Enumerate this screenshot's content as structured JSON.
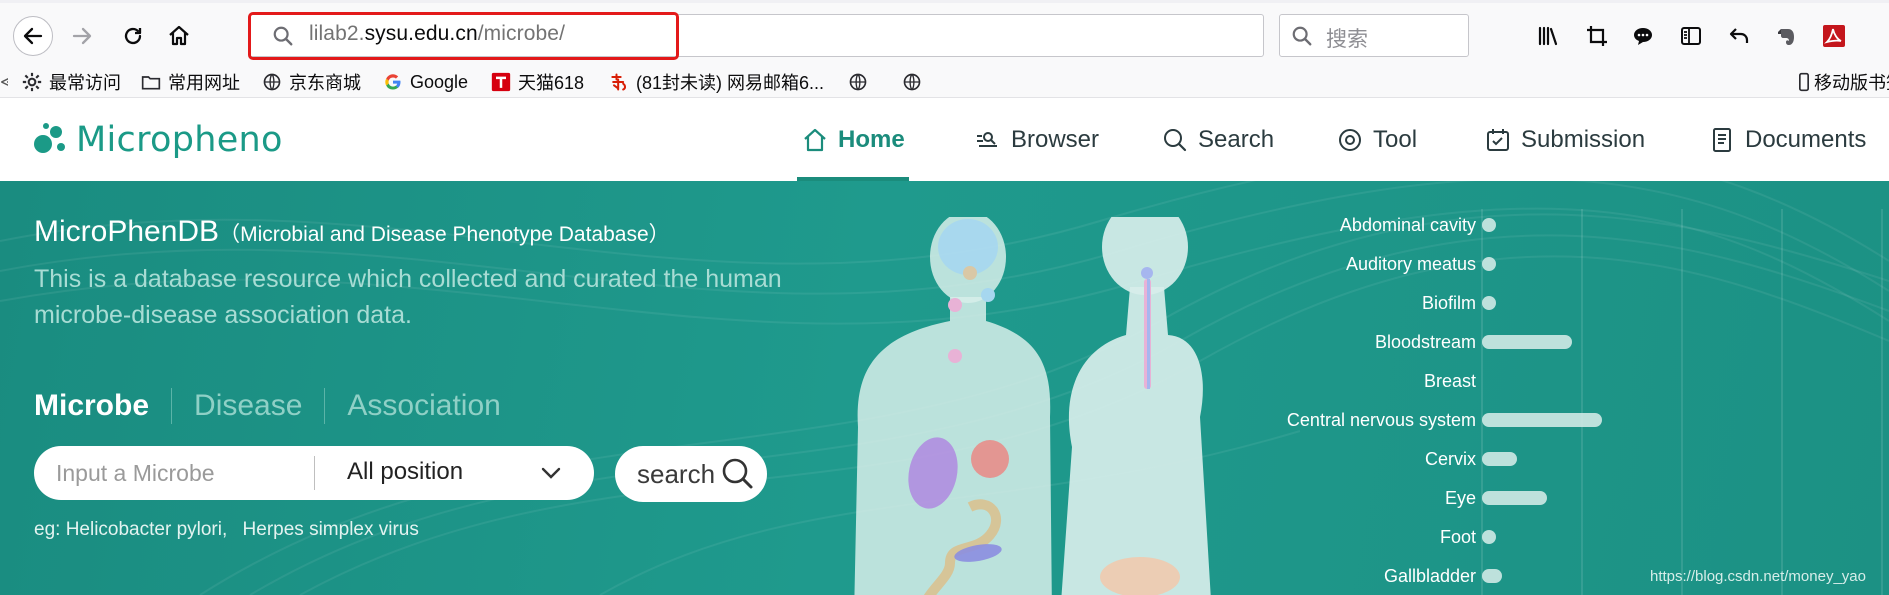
{
  "browser": {
    "url_prefix": "lilab2.",
    "url_domain": "sysu.edu.cn",
    "url_path": "/microbe/",
    "search_placeholder": "搜索"
  },
  "bookmarks": [
    {
      "label": "最常访问",
      "icon": "gear-icon"
    },
    {
      "label": "常用网址",
      "icon": "folder-icon"
    },
    {
      "label": "京东商城",
      "icon": "globe-icon"
    },
    {
      "label": "Google",
      "icon": "google-icon"
    },
    {
      "label": "天猫618",
      "icon": "tmall-icon"
    },
    {
      "label": "(81封未读) 网易邮箱6...",
      "icon": "netease-icon"
    },
    {
      "label": "移动版书签",
      "icon": "mobile-icon"
    }
  ],
  "site": {
    "logo_text": "Micropheno",
    "menu": [
      {
        "label": "Home",
        "icon": "home-icon",
        "active": true
      },
      {
        "label": "Browser",
        "icon": "browser-icon"
      },
      {
        "label": "Search",
        "icon": "search-icon"
      },
      {
        "label": "Tool",
        "icon": "tool-icon"
      },
      {
        "label": "Submission",
        "icon": "submission-icon"
      },
      {
        "label": "Documents",
        "icon": "documents-icon"
      }
    ]
  },
  "hero": {
    "title": "MicroPhenDB",
    "subtitle": "（Microbial and Disease Phenotype Database）",
    "description": "This is a database resource which collected and curated the human microbe-disease association data.",
    "tabs": [
      "Microbe",
      "Disease",
      "Association"
    ],
    "input_placeholder": "Input a Microbe",
    "position_select": "All position",
    "search_label": "search",
    "example_prefix": "eg: Helicobacter pylori,",
    "example_second": "Herpes simplex virus"
  },
  "chart_data": {
    "type": "bar",
    "orientation": "horizontal",
    "categories": [
      "Abdominal cavity",
      "Auditory meatus",
      "Biofilm",
      "Bloodstream",
      "Breast",
      "Central nervous system",
      "Cervix",
      "Eye",
      "Foot",
      "Gallbladder"
    ],
    "values": [
      1,
      1,
      0.5,
      9,
      0,
      12,
      3.5,
      6.5,
      1,
      2
    ],
    "xlim": [
      0,
      40
    ],
    "grid": true,
    "colors": {
      "bar": "#cfe9e5"
    }
  },
  "watermark": "https://blog.csdn.net/money_yao"
}
